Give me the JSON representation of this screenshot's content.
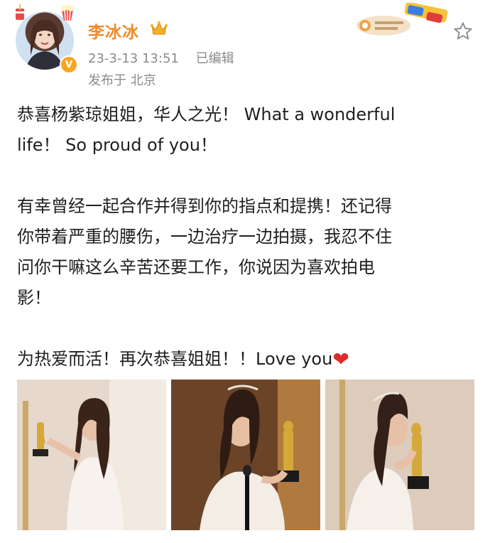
{
  "user": {
    "name": "李冰冰",
    "verified_mark": "V"
  },
  "post_meta": {
    "timestamp": "23-3-13 13:51",
    "edited": "已编辑",
    "location": "发布于 北京"
  },
  "post": {
    "line1": "恭喜杨紫琼姐姐，华人之光！ What a wonderful",
    "line2": "life！ So proud of you！",
    "line3": "有幸曾经一起合作并得到你的指点和提携！还记得",
    "line4": "你带着严重的腰伤，一边治疗一边拍摄，我忍不住",
    "line5": "问你干嘛这么辛苦还要工作，你说因为喜欢拍电",
    "line6": "影！",
    "line7": "为热爱而活！再次恭喜姐姐！！Love you",
    "heart": "❤"
  },
  "icons": {
    "crown": "crown-icon",
    "badge": "3d-glasses-badge-icon",
    "star": "star-icon"
  },
  "colors": {
    "username": "#f08a2a",
    "meta": "#8a8a8a",
    "heart": "#e02a2a"
  }
}
